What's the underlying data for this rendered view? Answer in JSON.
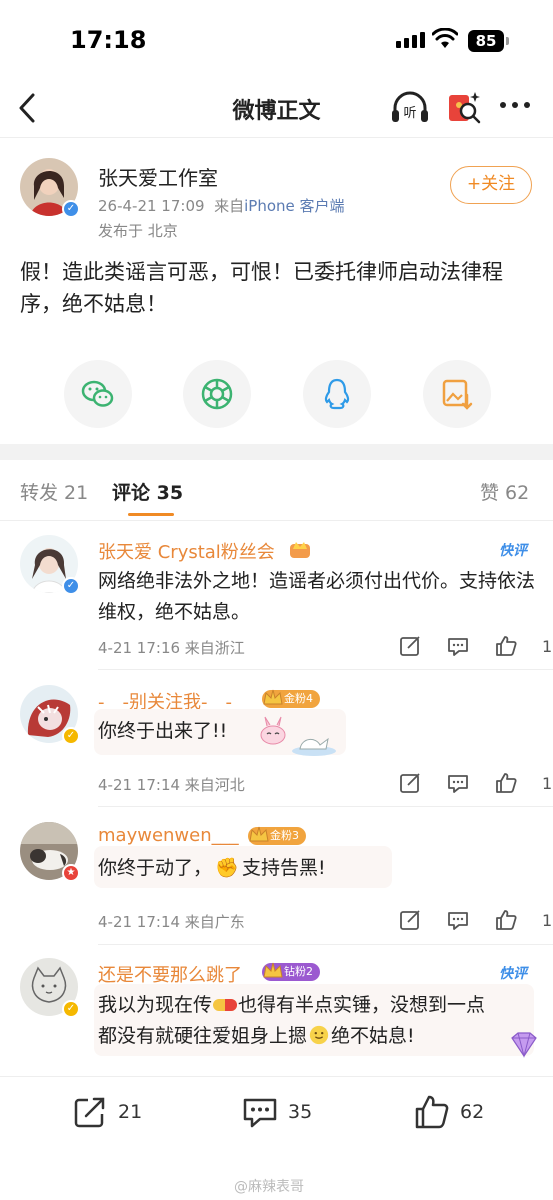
{
  "status_bar": {
    "time": "17:18",
    "battery": "85"
  },
  "nav": {
    "title": "微博正文",
    "listen_label": "听"
  },
  "post": {
    "author": "张天爱工作室",
    "time": "26-4-21 17:09",
    "source_prefix": "来自",
    "source": "iPhone 客户端",
    "location": "发布于 北京",
    "follow_label": "+关注",
    "text": "假！造此类谣言可恶，可恨！已委托律师启动法律程序，绝不姑息！"
  },
  "tabs": {
    "repost": "转发 21",
    "comment": "评论 35",
    "like": "赞 62"
  },
  "comments": [
    {
      "name": "张天爱 Crystal粉丝会",
      "text": "网络绝非法外之地！造谣者必须付出代价。支持依法维权，绝不姑息。",
      "meta": "4-21 17:16  来自浙江",
      "likes": "1",
      "tag": "快评"
    },
    {
      "name": "-__-别关注我-__-",
      "badge": "金粉4",
      "text": "你终于出来了!!",
      "meta": "4-21 17:14  来自河北",
      "likes": "1"
    },
    {
      "name": "maywenwen___",
      "badge": "金粉3",
      "text_before": "你终于动了，",
      "text_after": "支持告黑!",
      "meta": "4-21 17:14  来自广东",
      "likes": "1"
    },
    {
      "name": "还是不要那么跳了",
      "badge": "钻粉2",
      "text_a": "我以为现在传",
      "text_b": "也得有半点实锤，没想到一点",
      "text_c": "都没有就硬往爱姐身上摁",
      "text_d": "绝不姑息!",
      "tag": "快评"
    }
  ],
  "bottom": {
    "repost_count": "21",
    "comment_count": "35",
    "like_count": "62"
  },
  "watermark": "@麻辣表哥",
  "colors": {
    "accent": "#f08a24",
    "name": "#e8883a",
    "link": "#5b7bb2",
    "verified": "#3f8fe8"
  }
}
